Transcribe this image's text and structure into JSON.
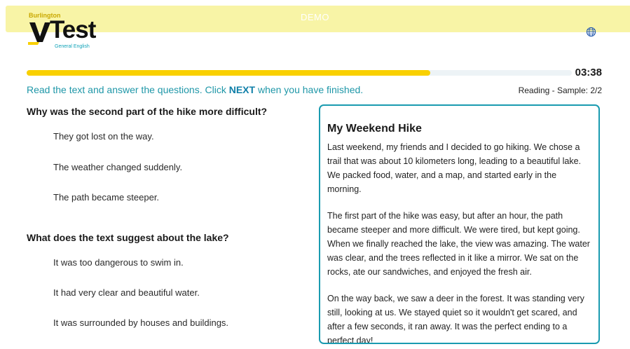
{
  "banner": {
    "label": "DEMO"
  },
  "logo": {
    "top_text": "Burlington",
    "main_text": "Test",
    "sub_text": "General English",
    "accent_color": "#f9d000"
  },
  "header": {
    "globe_icon": "globe-icon"
  },
  "progress": {
    "fraction": 0.74,
    "timer": "03:38"
  },
  "instruction": {
    "before": "Read the text and answer the questions. Click ",
    "emph": "NEXT",
    "after": " when you have finished."
  },
  "sample_info": "Reading - Sample: 2/2",
  "questions": [
    {
      "text": "Why was the second part of the hike more difficult?",
      "options": [
        "They got lost on the way.",
        "The weather changed suddenly.",
        "The path became steeper."
      ]
    },
    {
      "text": "What does the text suggest about the lake?",
      "options": [
        "It was too dangerous to swim in.",
        "It had very clear and beautiful water.",
        "It was surrounded by houses and buildings."
      ]
    }
  ],
  "reading": {
    "title": "My Weekend Hike",
    "paragraphs": [
      "Last weekend, my friends and I decided to go hiking. We chose a trail that was about 10 kilometers long, leading to a beautiful lake. We packed food, water, and a map, and started early in the morning.",
      "The first part of the hike was easy, but after an hour, the path became steeper and more difficult. We were tired, but kept going. When we finally reached the lake, the view was amazing. The water was clear, and the trees reflected in it like a mirror. We sat on the rocks, ate our sandwiches, and enjoyed the fresh air.",
      "On the way back, we saw a deer in the forest. It was standing very still, looking at us. We stayed quiet so it wouldn't get scared, and after a few seconds, it ran away. It was the perfect ending to a perfect day!"
    ]
  }
}
